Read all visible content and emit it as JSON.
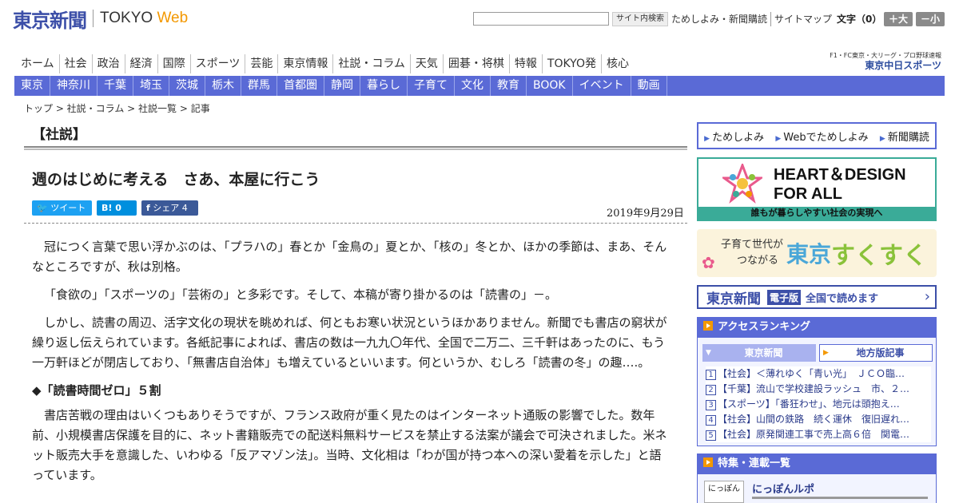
{
  "header": {
    "logo_jp": "東京新聞",
    "logo_en": "TOKYO",
    "logo_web": "Web",
    "search_button": "サイト内検索",
    "links": [
      "ためしよみ・新聞購読",
      "サイトマップ"
    ],
    "font_size_label": "文字（0）",
    "font_larger": "＋大",
    "font_smaller": "－小"
  },
  "global_nav": [
    "ホーム",
    "社会",
    "政治",
    "経済",
    "国際",
    "スポーツ",
    "芸能",
    "東京情報",
    "社説・コラム",
    "天気",
    "囲碁・将棋",
    "特報",
    "TOKYO発",
    "核心"
  ],
  "chunichi": {
    "small": "F1・FC東京・大リーグ・プロ野球速報",
    "name": "東京中日スポーツ"
  },
  "local_nav": [
    "東京",
    "神奈川",
    "千葉",
    "埼玉",
    "茨城",
    "栃木",
    "群馬",
    "首都圏",
    "静岡",
    "暮らし",
    "子育て",
    "文化",
    "教育",
    "BOOK",
    "イベント",
    "動画"
  ],
  "breadcrumb": "トップ > 社説・コラム > 社説一覧 > 記事",
  "article": {
    "section": "【社説】",
    "title": "週のはじめに考える　さあ、本屋に行こう",
    "share": {
      "tweet": "ツイート",
      "hatena_count": "0",
      "facebook": "シェア 4"
    },
    "date": "2019年9月29日",
    "paragraphs": [
      "冠につく言葉で思い浮かぶのは、「プラハの」春とか「金鳥の」夏とか、「核の」冬とか、ほかの季節は、まあ、そんなところですが、秋は別格。",
      "「食欲の」「スポーツの」「芸術の」と多彩です。そして、本稿が寄り掛かるのは「読書の」－。",
      "しかし、読書の周辺、活字文化の現状を眺めれば、何ともお寒い状況というほかありません。新聞でも書店の窮状が繰り返し伝えられています。各紙記事によれば、書店の数は一九九〇年代、全国で二万二、三千軒はあったのに、もう一万軒ほどが閉店しており、「無書店自治体」も増えているといいます。何というか、むしろ「読書の冬」の趣….。"
    ],
    "subheading": "◆「読書時間ゼロ」５割",
    "paragraph4": "書店苦戦の理由はいくつもありそうですが、フランス政府が重く見たのはインターネット通販の影響でした。数年前、小規模書店保護を目的に、ネット書籍販売での配送料無料サービスを禁止する法案が議会で可決されました。米ネット販売大手を意識した、いわゆる「反アマゾン法」。当時、文化相は「わが国が持つ本への深い愛着を示した」と語っています。"
  },
  "sidebar": {
    "buttons": [
      "ためしよみ",
      "Webでためしよみ",
      "新聞購読"
    ],
    "heart_design": {
      "title1": "HEART＆DESIGN",
      "title2": "FOR ALL",
      "caption": "誰もが暮らしやすい社会の実現へ"
    },
    "sukusuku": {
      "line1": "子育て世代が",
      "line2": "つながる",
      "tokyo": "東京",
      "name": "すくすく"
    },
    "epaper": {
      "logo": "東京新聞",
      "badge": "電子版",
      "text": "全国で読めます",
      "arrow": "›"
    },
    "ranking": {
      "title": "アクセスランキング",
      "tab1": "東京新聞",
      "tab2": "地方版記事",
      "items": [
        "【社会】＜薄れゆく「青い光」　ＪＣＯ臨…",
        "【千葉】流山で学校建設ラッシュ　市、２…",
        "【スポーツ】「番狂わせ」、地元は頭抱え…",
        "【社会】山間の鉄路　続く運休　復旧遅れ…",
        "【社会】原発関連工事で売上高６倍　関電…"
      ]
    },
    "features": {
      "title": "特集・連載一覧",
      "item": "にっぽんルポ",
      "thumb": "にっぽん"
    }
  },
  "colors": {
    "brand_blue": "#3c4fa8",
    "nav_blue": "#5a6ad6",
    "orange": "#f39800",
    "teal": "#3aab98"
  }
}
